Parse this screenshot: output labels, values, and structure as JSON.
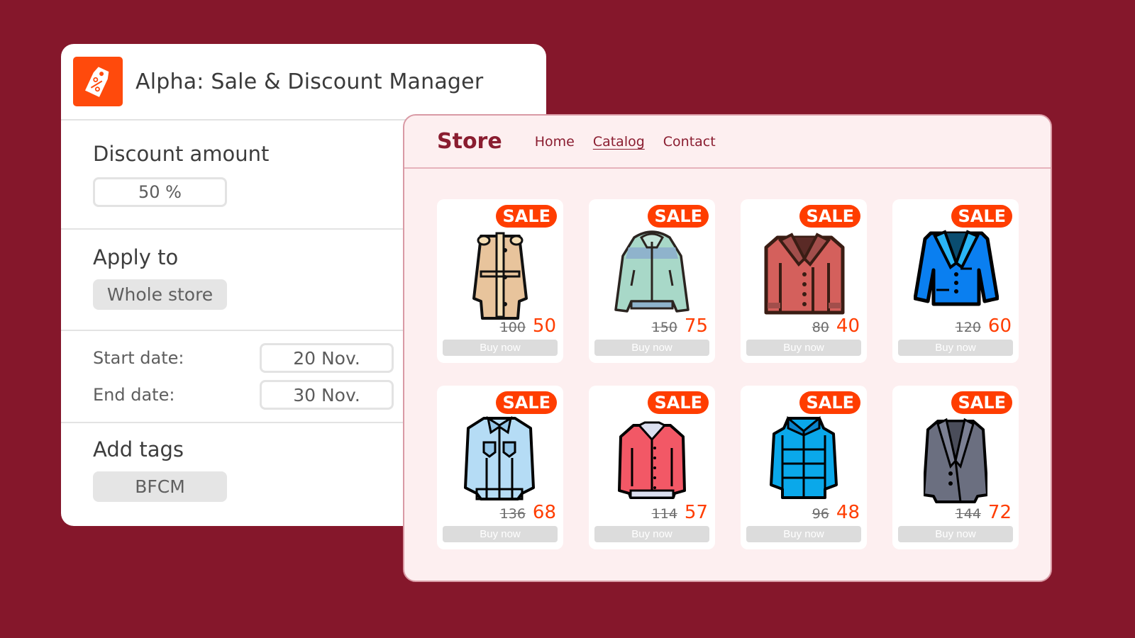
{
  "manager": {
    "title": "Alpha: Sale & Discount Manager",
    "logo_icon": "price-tag-percent-icon",
    "discount": {
      "label": "Discount amount",
      "value": "50 %"
    },
    "apply_to": {
      "label": "Apply to",
      "value": "Whole store"
    },
    "dates": {
      "start_label": "Start date:",
      "start_value": "20 Nov.",
      "end_label": "End date:",
      "end_value": "30 Nov."
    },
    "tags": {
      "label": "Add tags",
      "value": "BFCM"
    }
  },
  "store": {
    "brand": "Store",
    "nav": [
      {
        "label": "Home",
        "active": false
      },
      {
        "label": "Catalog",
        "active": true
      },
      {
        "label": "Contact",
        "active": false
      }
    ],
    "products": [
      {
        "badge": "SALE",
        "icon": "trench-coat-icon",
        "old_price": "100",
        "new_price": "50",
        "button": "Buy now",
        "colors": {
          "body": "#e8c49c",
          "accent": "#f5deb5"
        }
      },
      {
        "badge": "SALE",
        "icon": "bomber-jacket-icon",
        "old_price": "150",
        "new_price": "75",
        "button": "Buy now",
        "colors": {
          "body": "#a8d8c8",
          "accent": "#8fb3cc"
        }
      },
      {
        "badge": "SALE",
        "icon": "leather-jacket-icon",
        "old_price": "80",
        "new_price": "40",
        "button": "Buy now",
        "colors": {
          "body": "#d4605c",
          "accent": "#a24e4b"
        }
      },
      {
        "badge": "SALE",
        "icon": "blazer-icon",
        "old_price": "120",
        "new_price": "60",
        "button": "Buy now",
        "colors": {
          "body": "#0a7ff0",
          "accent": "#0a4d70"
        }
      },
      {
        "badge": "SALE",
        "icon": "denim-jacket-icon",
        "old_price": "136",
        "new_price": "68",
        "button": "Buy now",
        "colors": {
          "body": "#b5dcf5",
          "accent": "#94c6e8"
        }
      },
      {
        "badge": "SALE",
        "icon": "varsity-jacket-icon",
        "old_price": "114",
        "new_price": "57",
        "button": "Buy now",
        "colors": {
          "body": "#f25866",
          "accent": "#dce0f0"
        }
      },
      {
        "badge": "SALE",
        "icon": "puffer-jacket-icon",
        "old_price": "96",
        "new_price": "48",
        "button": "Buy now",
        "colors": {
          "body": "#0aa8ea",
          "accent": "#0a84cc"
        }
      },
      {
        "badge": "SALE",
        "icon": "suit-jacket-icon",
        "old_price": "144",
        "new_price": "72",
        "button": "Buy now",
        "colors": {
          "body": "#6b6f80",
          "accent": "#4a4d5a"
        }
      }
    ]
  },
  "colors": {
    "background": "#85172b",
    "sale": "#ff3d00",
    "brand_text": "#8a1d30",
    "store_bg": "#fdeff0"
  }
}
